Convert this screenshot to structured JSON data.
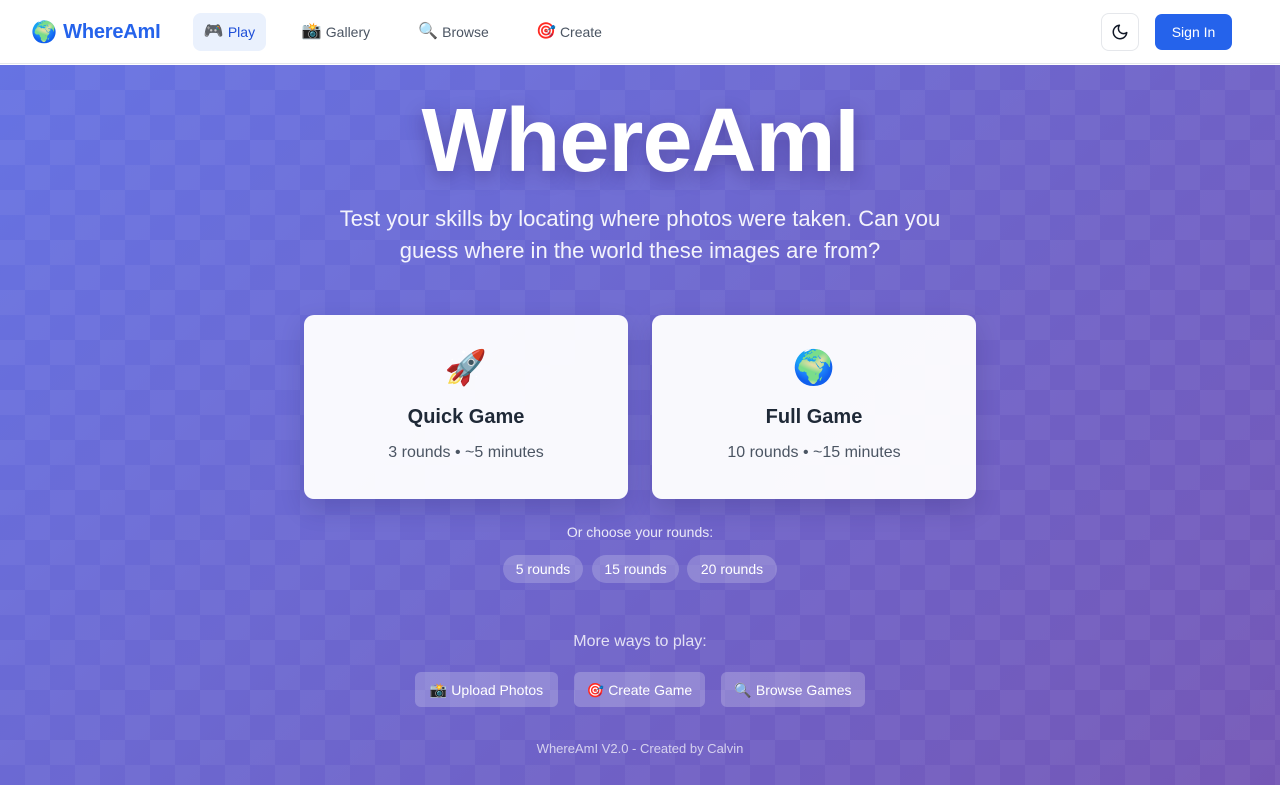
{
  "nav": {
    "brand": {
      "icon": "🌍",
      "icon_name": "globe-icon",
      "label": "WhereAmI"
    },
    "items": [
      {
        "icon": "🎮",
        "icon_name": "gamepad-icon",
        "label": "Play",
        "active": true
      },
      {
        "icon": "📸",
        "icon_name": "camera-icon",
        "label": "Gallery",
        "active": false
      },
      {
        "icon": "🔍",
        "icon_name": "magnifier-icon",
        "label": "Browse",
        "active": false
      },
      {
        "icon": "🎯",
        "icon_name": "target-icon",
        "label": "Create",
        "active": false
      }
    ],
    "theme_toggle_icon": "moon-icon",
    "sign_in_label": "Sign In"
  },
  "hero": {
    "title": "WhereAmI",
    "subtitle": "Test your skills by locating where photos were taken. Can you guess where in the world these images are from?"
  },
  "modes": [
    {
      "icon": "🚀",
      "icon_name": "rocket-icon",
      "title": "Quick Game",
      "meta": "3 rounds • ~5 minutes"
    },
    {
      "icon": "🌍",
      "icon_name": "globe-icon",
      "title": "Full Game",
      "meta": "10 rounds • ~15 minutes"
    }
  ],
  "rounds": {
    "label": "Or choose your rounds:",
    "options": [
      "5 rounds",
      "15 rounds",
      "20 rounds"
    ]
  },
  "more": {
    "label": "More ways to play:",
    "buttons": [
      {
        "icon": "📸",
        "icon_name": "camera-icon",
        "label": "Upload Photos"
      },
      {
        "icon": "🎯",
        "icon_name": "target-icon",
        "label": "Create Game"
      },
      {
        "icon": "🔍",
        "icon_name": "magnifier-icon",
        "label": "Browse Games"
      }
    ]
  },
  "footer": {
    "text": "WhereAmI V2.0 - Created by Calvin"
  },
  "colors": {
    "brand": "#2563eb",
    "gradient_start": "#6673e3",
    "gradient_end": "#7457b6"
  }
}
